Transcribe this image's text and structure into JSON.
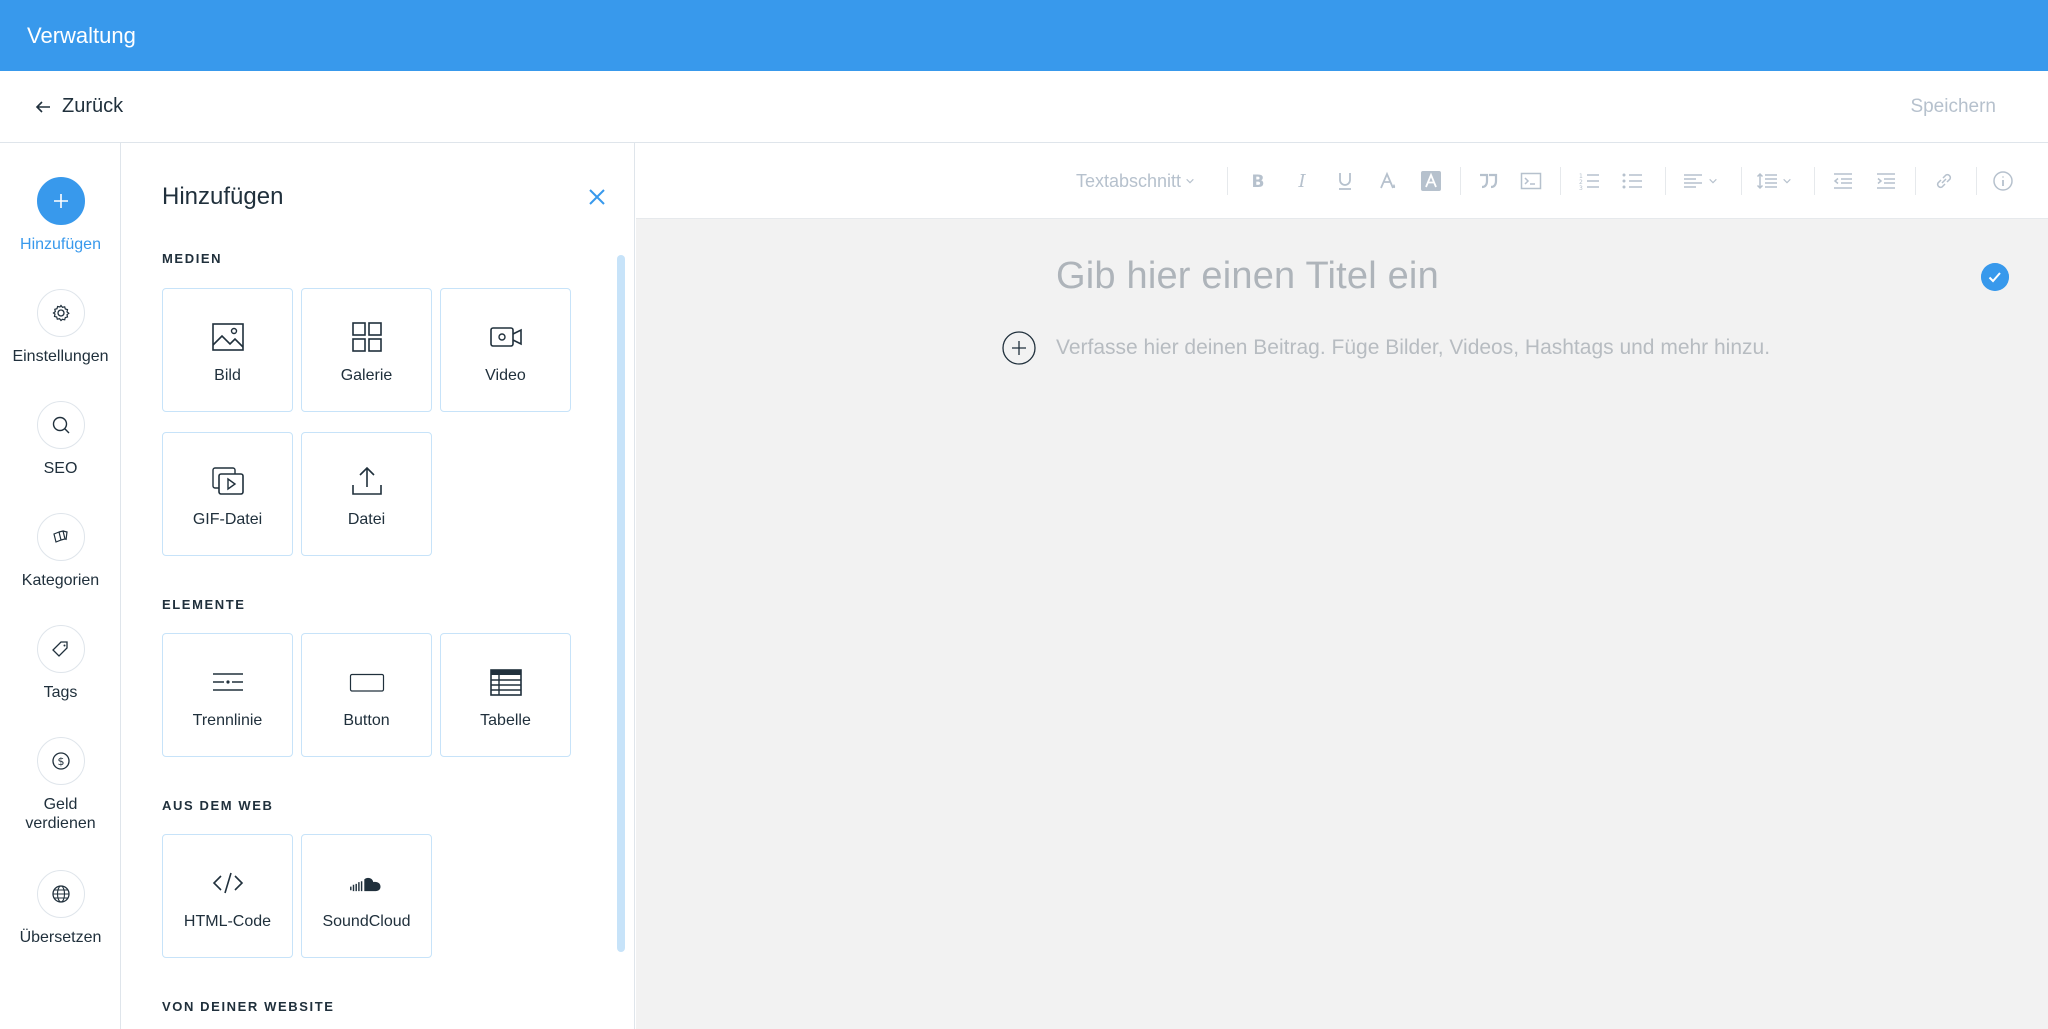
{
  "header": {
    "title": "Verwaltung"
  },
  "subbar": {
    "back_label": "Zurück",
    "save_label": "Speichern"
  },
  "rail": {
    "items": [
      {
        "label": "Hinzufügen",
        "icon": "plus-icon",
        "active": true
      },
      {
        "label": "Einstellungen",
        "icon": "gear-icon"
      },
      {
        "label": "SEO",
        "icon": "search-icon"
      },
      {
        "label": "Kategorien",
        "icon": "categories-icon"
      },
      {
        "label": "Tags",
        "icon": "tag-icon"
      },
      {
        "label": "Geld\nverdienen",
        "icon": "dollar-icon"
      },
      {
        "label": "Übersetzen",
        "icon": "globe-icon"
      }
    ]
  },
  "panel": {
    "title": "Hinzufügen",
    "sections": {
      "media": {
        "title": "MEDIEN",
        "tiles": [
          {
            "label": "Bild"
          },
          {
            "label": "Galerie"
          },
          {
            "label": "Video"
          },
          {
            "label": "GIF-Datei"
          },
          {
            "label": "Datei"
          }
        ]
      },
      "elements": {
        "title": "ELEMENTE",
        "tiles": [
          {
            "label": "Trennlinie"
          },
          {
            "label": "Button"
          },
          {
            "label": "Tabelle"
          }
        ]
      },
      "web": {
        "title": "AUS DEM WEB",
        "tiles": [
          {
            "label": "HTML-Code"
          },
          {
            "label": "SoundCloud"
          }
        ]
      },
      "site": {
        "title": "VON DEINER WEBSITE"
      }
    }
  },
  "toolbar": {
    "text_style": "Textabschnitt"
  },
  "editor": {
    "title_placeholder": "Gib hier einen Titel ein",
    "body_placeholder": "Verfasse hier deinen Beitrag. Füge Bilder, Videos, Hashtags und mehr hinzu."
  },
  "colors": {
    "accent": "#3899ec",
    "border": "#dfe5eb",
    "tile_border": "#c7e3f9",
    "canvas": "#f2f2f2"
  }
}
